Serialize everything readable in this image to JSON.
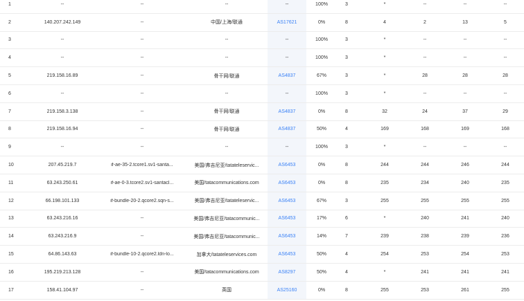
{
  "hops": [
    {
      "hop": "1",
      "ip": "--",
      "host": "--",
      "location": "--",
      "asn": "--",
      "loss": "100%",
      "sent": "3",
      "last": "*",
      "avg": "--",
      "best": "--",
      "worst": "--"
    },
    {
      "hop": "2",
      "ip": "140.207.242.149",
      "host": "--",
      "location": "中国/上海/联通",
      "asn": "AS17621",
      "loss": "0%",
      "sent": "8",
      "last": "4",
      "avg": "2",
      "best": "13",
      "worst": "5"
    },
    {
      "hop": "3",
      "ip": "--",
      "host": "--",
      "location": "--",
      "asn": "--",
      "loss": "100%",
      "sent": "3",
      "last": "*",
      "avg": "--",
      "best": "--",
      "worst": "--"
    },
    {
      "hop": "4",
      "ip": "--",
      "host": "--",
      "location": "--",
      "asn": "--",
      "loss": "100%",
      "sent": "3",
      "last": "*",
      "avg": "--",
      "best": "--",
      "worst": "--"
    },
    {
      "hop": "5",
      "ip": "219.158.16.89",
      "host": "--",
      "location": "骨干网/联通",
      "asn": "AS4837",
      "loss": "67%",
      "sent": "3",
      "last": "*",
      "avg": "28",
      "best": "28",
      "worst": "28"
    },
    {
      "hop": "6",
      "ip": "--",
      "host": "--",
      "location": "--",
      "asn": "--",
      "loss": "100%",
      "sent": "3",
      "last": "*",
      "avg": "--",
      "best": "--",
      "worst": "--"
    },
    {
      "hop": "7",
      "ip": "219.158.3.138",
      "host": "--",
      "location": "骨干网/联通",
      "asn": "AS4837",
      "loss": "0%",
      "sent": "8",
      "last": "32",
      "avg": "24",
      "best": "37",
      "worst": "29"
    },
    {
      "hop": "8",
      "ip": "219.158.16.94",
      "host": "--",
      "location": "骨干网/联通",
      "asn": "AS4837",
      "loss": "50%",
      "sent": "4",
      "last": "169",
      "avg": "168",
      "best": "169",
      "worst": "168"
    },
    {
      "hop": "9",
      "ip": "--",
      "host": "--",
      "location": "--",
      "asn": "--",
      "loss": "100%",
      "sent": "3",
      "last": "*",
      "avg": "--",
      "best": "--",
      "worst": "--"
    },
    {
      "hop": "10",
      "ip": "207.45.219.7",
      "host": "if-ae-35-2.tcore1.sv1-santa...",
      "location": "美国/弗吉尼亚/tatateleservic...",
      "asn": "AS6453",
      "loss": "0%",
      "sent": "8",
      "last": "244",
      "avg": "244",
      "best": "246",
      "worst": "244"
    },
    {
      "hop": "11",
      "ip": "63.243.250.61",
      "host": "if-ae-0-3.tcore2.sv1-santacl...",
      "location": "美国/tatacommunications.com",
      "asn": "AS6453",
      "loss": "0%",
      "sent": "8",
      "last": "235",
      "avg": "234",
      "best": "240",
      "worst": "235"
    },
    {
      "hop": "12",
      "ip": "66.198.101.133",
      "host": "if-bundle-20-2.qcore2.sqn-s...",
      "location": "美国/弗吉尼亚/tatateleservic...",
      "asn": "AS6453",
      "loss": "67%",
      "sent": "3",
      "last": "255",
      "avg": "255",
      "best": "255",
      "worst": "255"
    },
    {
      "hop": "13",
      "ip": "63.243.216.16",
      "host": "--",
      "location": "美国/弗吉尼亚/tatacommunic...",
      "asn": "AS6453",
      "loss": "17%",
      "sent": "6",
      "last": "*",
      "avg": "240",
      "best": "241",
      "worst": "240"
    },
    {
      "hop": "14",
      "ip": "63.243.216.9",
      "host": "--",
      "location": "美国/弗吉尼亚/tatacommunic...",
      "asn": "AS6453",
      "loss": "14%",
      "sent": "7",
      "last": "239",
      "avg": "238",
      "best": "239",
      "worst": "236"
    },
    {
      "hop": "15",
      "ip": "64.86.143.63",
      "host": "if-bundle-10-2.qcore2.ldn-lo...",
      "location": "加拿大/tatateleservices.com",
      "asn": "AS6453",
      "loss": "50%",
      "sent": "4",
      "last": "254",
      "avg": "253",
      "best": "254",
      "worst": "253"
    },
    {
      "hop": "16",
      "ip": "195.219.213.128",
      "host": "--",
      "location": "美国/tatacommunications.com",
      "asn": "AS8297",
      "loss": "50%",
      "sent": "4",
      "last": "*",
      "avg": "241",
      "best": "241",
      "worst": "241"
    },
    {
      "hop": "17",
      "ip": "158.41.104.97",
      "host": "--",
      "location": "英国",
      "asn": "AS25160",
      "loss": "0%",
      "sent": "8",
      "last": "255",
      "avg": "253",
      "best": "261",
      "worst": "255"
    }
  ]
}
